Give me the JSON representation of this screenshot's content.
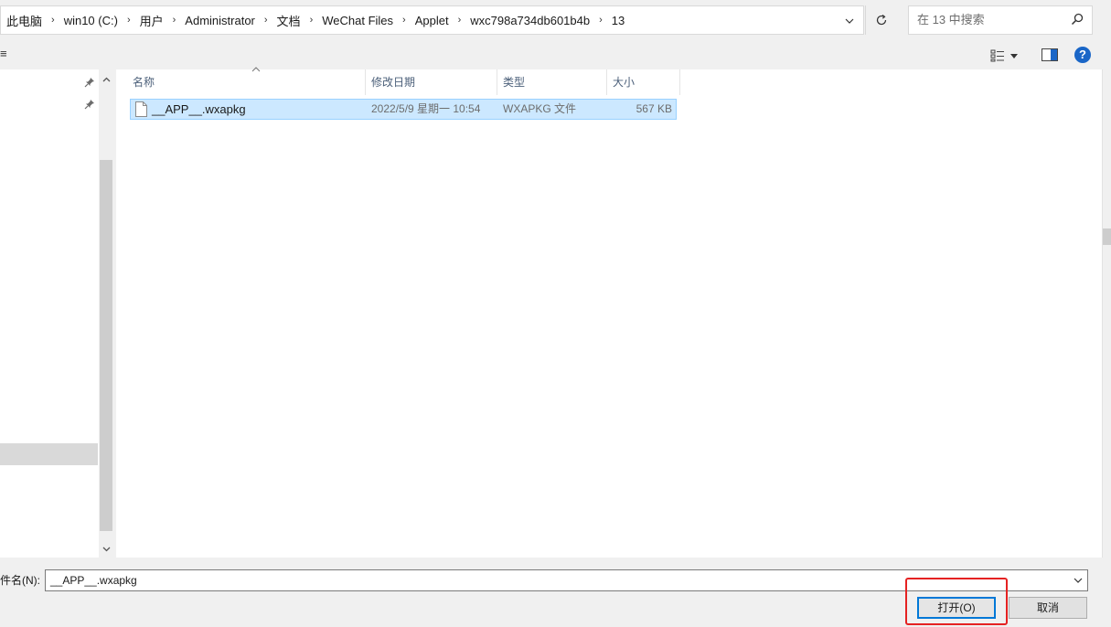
{
  "address_bar": {
    "crumbs": [
      "此电脑",
      "win10 (C:)",
      "用户",
      "Administrator",
      "文档",
      "WeChat Files",
      "Applet",
      "wxc798a734db601b4b",
      "13"
    ]
  },
  "search": {
    "placeholder": "在 13 中搜索"
  },
  "toolbar": {
    "left_fragment": "≡"
  },
  "columns": {
    "name": "名称",
    "date": "修改日期",
    "type": "类型",
    "size": "大小"
  },
  "files": [
    {
      "name": "__APP__.wxapkg",
      "date": "2022/5/9 星期一 10:54",
      "type": "WXAPKG 文件",
      "size": "567 KB"
    }
  ],
  "bottom": {
    "filename_label": "件名(N):",
    "filename_value": "__APP__.wxapkg",
    "open_label": "打开(O)",
    "cancel_label": "取消"
  },
  "colors": {
    "selection_bg": "#cce8ff",
    "selection_border": "#99d1ff",
    "accent": "#0078d7",
    "annotation": "#e52222"
  }
}
